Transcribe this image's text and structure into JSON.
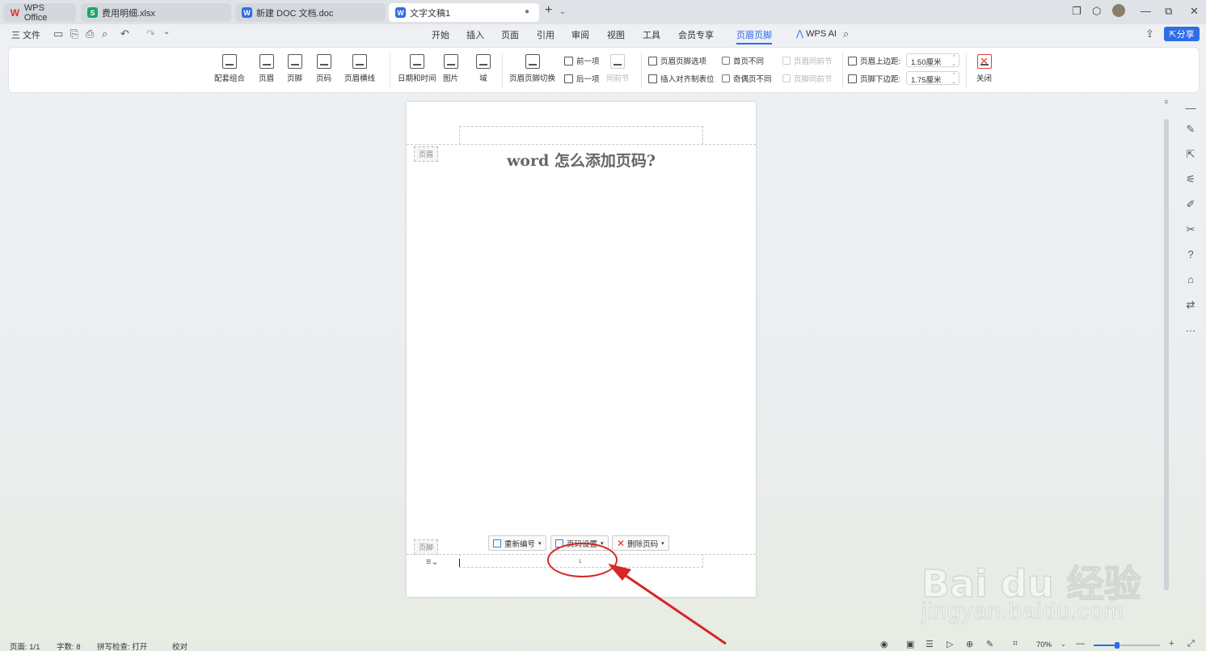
{
  "tabs": [
    {
      "label": "WPS Office",
      "icon": "wps-logo-icon"
    },
    {
      "label": "费用明细.xlsx",
      "icon": "spreadsheet-icon",
      "icon_letter": "S"
    },
    {
      "label": "新建 DOC 文档.doc",
      "icon": "writer-icon",
      "icon_letter": "W"
    },
    {
      "label": "文字文稿1",
      "icon": "writer-icon",
      "icon_letter": "W",
      "active": true
    }
  ],
  "file_menu": "三 文件",
  "menu": [
    "开始",
    "插入",
    "页面",
    "引用",
    "审阅",
    "视图",
    "工具",
    "会员专享",
    "页眉页脚"
  ],
  "active_menu": "页眉页脚",
  "wps_ai": "WPS AI",
  "share": "分享",
  "ribbon": {
    "big_buttons": [
      "配套组合",
      "页眉",
      "页脚",
      "页码",
      "页眉横线",
      "日期和时间",
      "图片",
      "域",
      "页眉页脚切换"
    ],
    "prev": "前一项",
    "next": "后一项",
    "same_as_prev": "同前节",
    "hf_options": "页眉页脚选项",
    "insert_align_tab": "插入对齐制表位",
    "diff_first": "首页不同",
    "diff_odd_even": "奇偶页不同",
    "header_same_prev": "页眉同前节",
    "footer_same_prev": "页脚同前节",
    "header_top_label": "页眉上边距:",
    "header_top_value": "1.50厘米",
    "footer_bottom_label": "页脚下边距:",
    "footer_bottom_value": "1.75厘米",
    "close": "关闭"
  },
  "document": {
    "title": "word 怎么添加页码?",
    "header_tag": "页眉",
    "footer_tag": "页脚",
    "renumber": "重新编号",
    "page_setup": "页码设置",
    "delete_page_num": "删除页码",
    "page_number": "1"
  },
  "status": {
    "page": "页面: 1/1",
    "words": "字数: 8",
    "spell": "拼写检查: 打开",
    "proof": "校对",
    "zoom": "70%"
  },
  "watermark": {
    "brand": "Bai du 经验",
    "url": "jingyan.baidu.com"
  }
}
